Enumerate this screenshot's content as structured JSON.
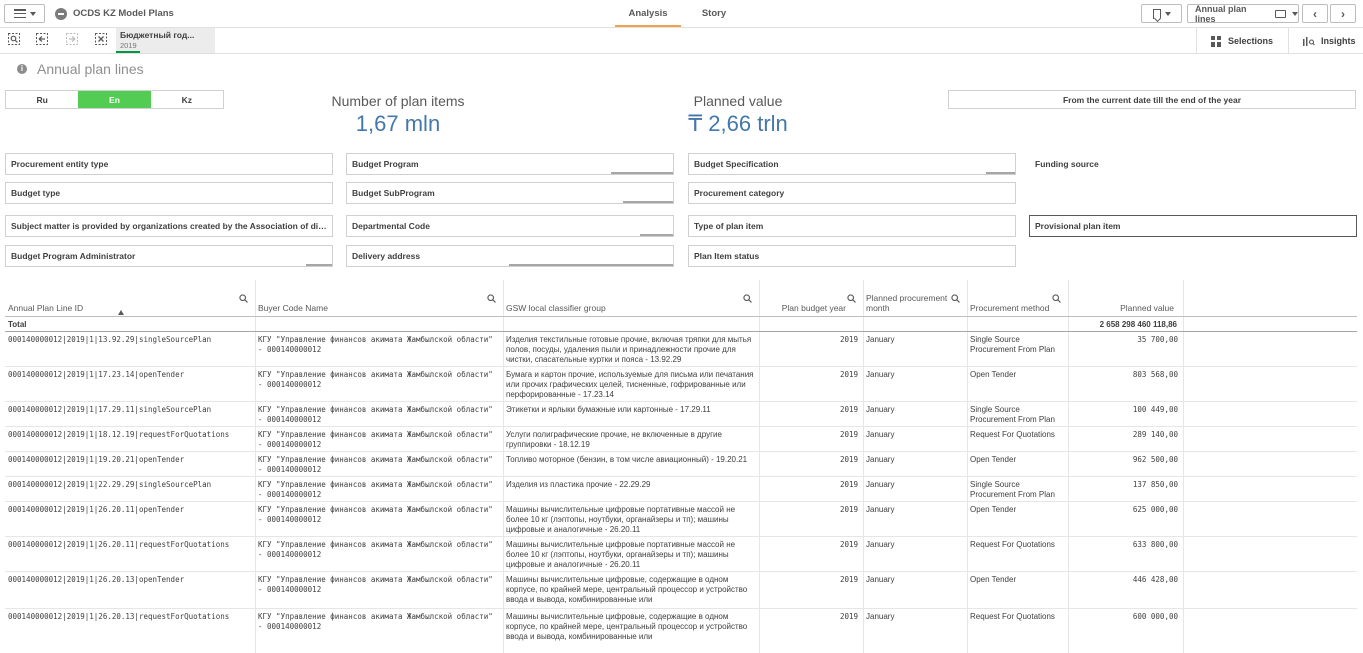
{
  "app": {
    "title": "OCDS KZ Model Plans"
  },
  "tabs": [
    {
      "label": "Analysis"
    },
    {
      "label": "Story"
    }
  ],
  "toolbar": {
    "sheet_selector_label": "Annual plan lines",
    "prev_icon": "chevron-left-icon",
    "next_icon": "chevron-right-icon"
  },
  "selection_bar": {
    "chip": {
      "title": "Бюджетный год...",
      "value": "2019"
    },
    "selections_label": "Selections",
    "insights_label": "Insights"
  },
  "sheet": {
    "title": "Annual plan lines"
  },
  "language": {
    "options": [
      "Ru",
      "En",
      "Kz"
    ],
    "selected": "En"
  },
  "kpis": [
    {
      "label": "Number of plan items",
      "value": "1,67 mln"
    },
    {
      "label": "Planned value",
      "value": "₸ 2,66 trln"
    }
  ],
  "date_filter": {
    "label": "From the current date till the end of the year"
  },
  "filters": [
    "Procurement entity type",
    "Budget Program",
    "Budget Specification",
    "Funding source",
    "Budget type",
    "Budget SubProgram",
    "Procurement category",
    "Subject matter is provided by organizations created by the Association of disab...",
    "Departmental Code",
    "Type of plan item",
    "Provisional plan item",
    "Budget Program Administrator",
    "Delivery address",
    "Plan Item status"
  ],
  "table": {
    "columns": [
      "Annual Plan Line ID",
      "Buyer Code Name",
      "GSW local classifier group",
      "Plan budget year",
      "Planned procurement month",
      "Procurement method",
      "Planned value"
    ],
    "total_label": "Total",
    "total_value": "2 658 298 460 118,86",
    "rows": [
      {
        "id": "000140000012|2019|1|13.92.29|singleSourcePlan",
        "buyer": "КГУ \"Управление финансов акимата Жамбылской области\" - 000140000012",
        "gsw": "Изделия текстильные готовые прочие, включая тряпки для мытья полов, посуды, удаления пыли и принадлежности прочие для чистки, спасательные куртки и пояса - 13.92.29",
        "year": "2019",
        "month": "January",
        "method": "Single Source Procurement From Plan",
        "value": "35 700,00"
      },
      {
        "id": "000140000012|2019|1|17.23.14|openTender",
        "buyer": "КГУ \"Управление финансов акимата Жамбылской области\" - 000140000012",
        "gsw": "Бумага и картон прочие, используемые для письма или печатания или прочих графических целей, тисненные, гофрированные или перфорированные - 17.23.14",
        "year": "2019",
        "month": "January",
        "method": "Open Tender",
        "value": "803 568,00"
      },
      {
        "id": "000140000012|2019|1|17.29.11|singleSourcePlan",
        "buyer": "КГУ \"Управление финансов акимата Жамбылской области\" - 000140000012",
        "gsw": "Этикетки и ярлыки бумажные или картонные - 17.29.11",
        "year": "2019",
        "month": "January",
        "method": "Single Source Procurement From Plan",
        "value": "100 449,00"
      },
      {
        "id": "000140000012|2019|1|18.12.19|requestForQuotations",
        "buyer": "КГУ \"Управление финансов акимата Жамбылской области\" - 000140000012",
        "gsw": "Услуги полиграфические прочие, не включенные в другие группировки - 18.12.19",
        "year": "2019",
        "month": "January",
        "method": "Request For Quotations",
        "value": "289 140,00"
      },
      {
        "id": "000140000012|2019|1|19.20.21|openTender",
        "buyer": "КГУ \"Управление финансов акимата Жамбылской области\" - 000140000012",
        "gsw": "Топливо моторное (бензин, в том числе авиационный) - 19.20.21",
        "year": "2019",
        "month": "January",
        "method": "Open Tender",
        "value": "962 500,00"
      },
      {
        "id": "000140000012|2019|1|22.29.29|singleSourcePlan",
        "buyer": "КГУ \"Управление финансов акимата Жамбылской области\" - 000140000012",
        "gsw": "Изделия из пластика прочие - 22.29.29",
        "year": "2019",
        "month": "January",
        "method": "Single Source Procurement From Plan",
        "value": "137 850,00"
      },
      {
        "id": "000140000012|2019|1|26.20.11|openTender",
        "buyer": "КГУ \"Управление финансов акимата Жамбылской области\" - 000140000012",
        "gsw": "Машины вычислительные цифровые портативные массой не более 10 кг (лэптопы, ноутбуки, органайзеры и тп); машины цифровые и аналогичные - 26.20.11",
        "year": "2019",
        "month": "January",
        "method": "Open Tender",
        "value": "625 000,00"
      },
      {
        "id": "000140000012|2019|1|26.20.11|requestForQuotations",
        "buyer": "КГУ \"Управление финансов акимата Жамбылской области\" - 000140000012",
        "gsw": "Машины вычислительные цифровые портативные массой не более 10 кг (лэптопы, ноутбуки, органайзеры и тп); машины цифровые и аналогичные - 26.20.11",
        "year": "2019",
        "month": "January",
        "method": "Request For Quotations",
        "value": "633 800,00"
      },
      {
        "id": "000140000012|2019|1|26.20.13|openTender",
        "buyer": "КГУ \"Управление финансов акимата Жамбылской области\" - 000140000012",
        "gsw": "Машины вычислительные цифровые, содержащие в одном корпусе, по крайней мере, центральный процессор и устройство ввода и вывода, комбинированные или",
        "year": "2019",
        "month": "January",
        "method": "Open Tender",
        "value": "446 428,00"
      },
      {
        "id": "000140000012|2019|1|26.20.13|requestForQuotations",
        "buyer": "КГУ \"Управление финансов акимата Жамбылской области\" - 000140000012",
        "gsw": "Машины вычислительные цифровые, содержащие в одном корпусе, по крайней мере, центральный процессор и устройство ввода и вывода, комбинированные или",
        "year": "2019",
        "month": "January",
        "method": "Request For Quotations",
        "value": "600 000,00"
      }
    ]
  },
  "colors": {
    "accent_green": "#52cc52",
    "kpi_blue": "#4477aa",
    "tab_underline": "#f0a34a",
    "chip_green": "#009845"
  }
}
